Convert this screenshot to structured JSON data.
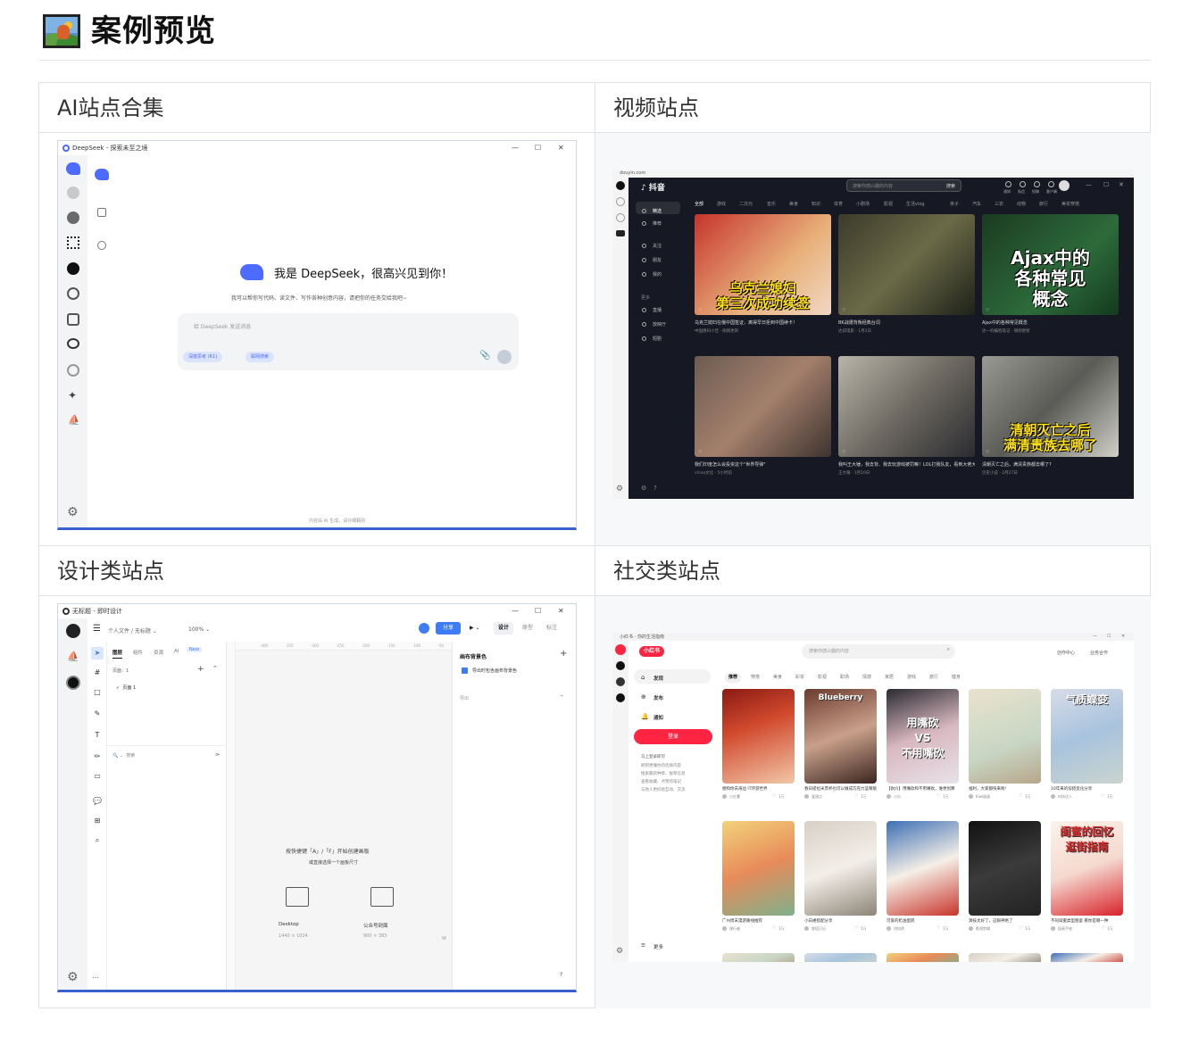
{
  "page": {
    "title": "案例预览"
  },
  "sections": [
    {
      "title": "AI站点合集"
    },
    {
      "title": "视频站点"
    },
    {
      "title": "设计类站点"
    },
    {
      "title": "社交类站点"
    }
  ],
  "deepseek": {
    "window_title": "DeepSeek - 探索未至之境",
    "greeting": "我是 DeepSeek，很高兴见到你！",
    "subtitle": "我可以帮你写代码、读文件、写作各种创意内容，请把你的任务交给我吧~",
    "input_placeholder": "给 DeepSeek 发送消息",
    "deep_think_label": "深度思考 (R1)",
    "web_search_label": "联网搜索",
    "footer": "内容由 AI 生成，请仔细甄别"
  },
  "douyin": {
    "window_title": "douyin.com",
    "logo": "抖音",
    "search_placeholder": "搜索你感兴趣的内容",
    "search_button": "搜索",
    "top_actions": [
      "通知",
      "私信",
      "投稿",
      "客户端"
    ],
    "sidebar_items": [
      "精选",
      "推荐",
      "关注",
      "朋友",
      "我的",
      "直播",
      "放映厅",
      "短剧"
    ],
    "sidebar_group": "更多",
    "categories": [
      "全部",
      "游戏",
      "二次元",
      "音乐",
      "美食",
      "知识",
      "体育",
      "小剧场",
      "影视",
      "生活vlog",
      "亲子",
      "汽车",
      "三农",
      "动物",
      "旅行",
      "美妆穿搭"
    ],
    "videos": [
      {
        "overlay": "乌克兰媳妇\n第三次成功续签",
        "title": "乌克兰媳妇在俄中国签证，离得早日拒到中国续卡！",
        "author": "中国媳妇小佳",
        "date": "刚刚更新"
      },
      {
        "overlay": "",
        "title": "BK战遭背叛经典台词",
        "author": "达叔电影",
        "date": "1月2日"
      },
      {
        "overlay": "Ajax中的\n各种常见\n概念",
        "title": "Ajax中的各种常见概念",
        "author": "达一的编程笔记",
        "date": "刚刚更新"
      },
      {
        "overlay": "",
        "title": "我们印度怎么会投资这个\"世界导弹\"",
        "author": "china文化",
        "date": "5小时前"
      },
      {
        "overlay": "",
        "title": "我叫王大锤，我去背、我去玩游戏被罚嘛！LOL打我队友，看到大佬大佬就叫了~",
        "author": "王大锤",
        "date": "1月10日"
      },
      {
        "overlay": "清朝灭亡之后\n满清贵族去哪了",
        "title": "清朝灭亡之后，满清贵族都去哪了?",
        "author": "历史小说",
        "date": "2月27日"
      }
    ]
  },
  "design": {
    "window_title": "无标题 - 即时设计",
    "breadcrumb": "个人文件 / 无标题",
    "zoom": "100%",
    "share_button": "分享",
    "mode_tabs": [
      "设计",
      "原型",
      "标注"
    ],
    "panel_tabs": [
      "图层",
      "组件",
      "资源",
      "AI"
    ],
    "new_badge": "New",
    "pages_label": "页面：1",
    "page_item": "页面 1",
    "search_placeholder": "搜索",
    "right_panel_title": "画布背景色",
    "export_bg_label": "导出时包含画布背景色",
    "export_label": "导出",
    "ruler_marks": [
      "-400",
      "-350",
      "-300",
      "-250",
      "-200",
      "-150",
      "-100",
      "-50"
    ],
    "hint_line1": "按快捷键「A」/「F」开始创建画板",
    "hint_line2": "或直接选择一个画板尺寸",
    "frames": [
      {
        "name": "Desktop",
        "size": "1440 × 1024"
      },
      {
        "name": "公众号封面",
        "size": "900 × 383"
      }
    ],
    "help": "?"
  },
  "xhs": {
    "window_title": "小红书 - 你的生活指南",
    "logo": "小红书",
    "search_placeholder": "搜索你感兴趣的内容",
    "top_links": [
      "创作中心",
      "业务合作"
    ],
    "nav": [
      "发现",
      "发布",
      "通知"
    ],
    "login_button": "登录",
    "login_hint_title": "马上登录即可",
    "login_hints": [
      "刷到更懂你的优质内容",
      "搜索最新种草、拔草信息",
      "查看收藏、点赞的笔记",
      "与他人更好地互动、交流"
    ],
    "more": "更多",
    "channels": [
      "推荐",
      "穿搭",
      "美食",
      "彩妆",
      "影视",
      "职场",
      "情感",
      "家居",
      "游戏",
      "旅行",
      "健身"
    ],
    "notes": [
      {
        "overlay": "",
        "title": "想和你去海边 IT环游世界",
        "author": "小红薯",
        "likes": "1万"
      },
      {
        "overlay": "Blueberry",
        "title": "春日提拉米苏杯也可以做成巧克力蓝莓版",
        "author": "爱甜点",
        "likes": "1万"
      },
      {
        "overlay": "用嘴砍\nVS\n不用嘴砍",
        "title": "【砍价】用嘴砍和不用嘴砍，谁更划算",
        "author": "小乐",
        "likes": "1万"
      },
      {
        "overlay": "",
        "title": "福利，大家都快来啦！",
        "author": "Kiwi插画",
        "likes": "1万"
      },
      {
        "overlay": "气质蝶变",
        "title": "10年来的穿搭变化分享",
        "author": "时尚达人",
        "likes": "1万"
      },
      {
        "overlay": "",
        "title": "广州周末漫游路线推荐",
        "author": "旅行者",
        "likes": "1万"
      },
      {
        "overlay": "",
        "title": "小白裙搭配分享",
        "author": "穿搭日记",
        "likes": "1万"
      },
      {
        "overlay": "",
        "title": "可爱的奶油蛋糕",
        "author": "烘焙师",
        "likes": "1万"
      },
      {
        "overlay": "",
        "title": "演技太好了，这眼神绝了",
        "author": "影视剪辑",
        "likes": "1万"
      },
      {
        "overlay": "闺蜜的回忆\n逛街指南",
        "title": "不同闺蜜类型图鉴 看你是哪一种",
        "author": "插画手账",
        "likes": "1万"
      }
    ]
  }
}
